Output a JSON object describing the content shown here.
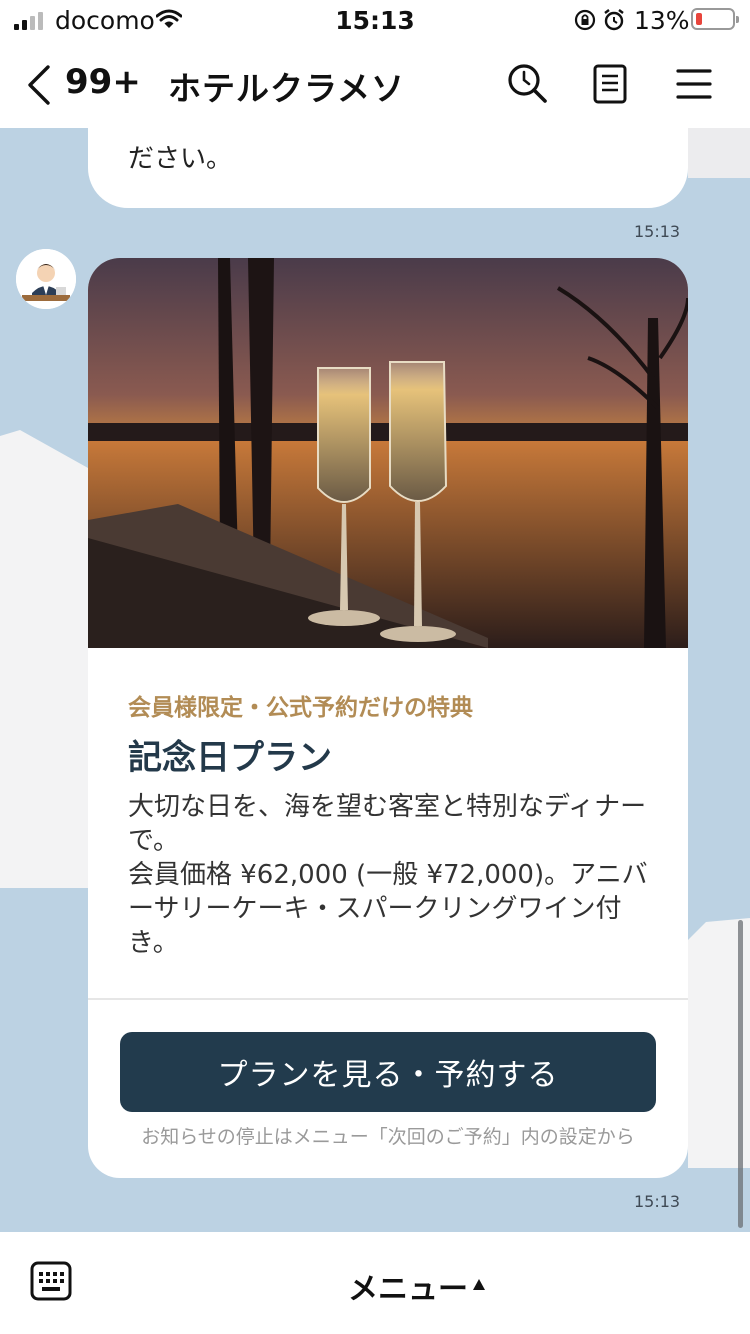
{
  "status_bar": {
    "carrier": "docomo",
    "time": "15:13",
    "battery_percent": "13%",
    "battery_level": 0.13,
    "signal_bars": 2,
    "icons": [
      "signal-icon",
      "wifi-icon",
      "rotation-lock-icon",
      "alarm-icon",
      "battery-icon"
    ]
  },
  "header": {
    "unread_count": "99+",
    "title": "ホテルクラメソ",
    "icons": [
      "back-icon",
      "search-icon",
      "notes-icon",
      "menu-icon"
    ]
  },
  "chat": {
    "background_color": "#bcd2e3",
    "previous_message": {
      "cut_text": "　　　　　　　　　",
      "text": "ださい。",
      "time": "15:13"
    },
    "card": {
      "tagline": "会員様限定・公式予約だけの特典",
      "title": "記念日プラン",
      "description_lines": [
        "大切な日を、海を望む客室と特別なディナーで。",
        "会員価格 ¥62,000 (一般 ¥72,000)。アニバーサリーケーキ・スパークリングワイン付き。"
      ],
      "button_label": "プランを見る・予約する",
      "note": "お知らせの停止はメニュー「次回のご予約」内の設定から",
      "time": "15:13",
      "accent_color": "#b28c55",
      "button_color": "#223b4d"
    }
  },
  "bottom_bar": {
    "menu_label": "メニュー",
    "icons": [
      "keyboard-icon",
      "caret-up-icon"
    ]
  }
}
